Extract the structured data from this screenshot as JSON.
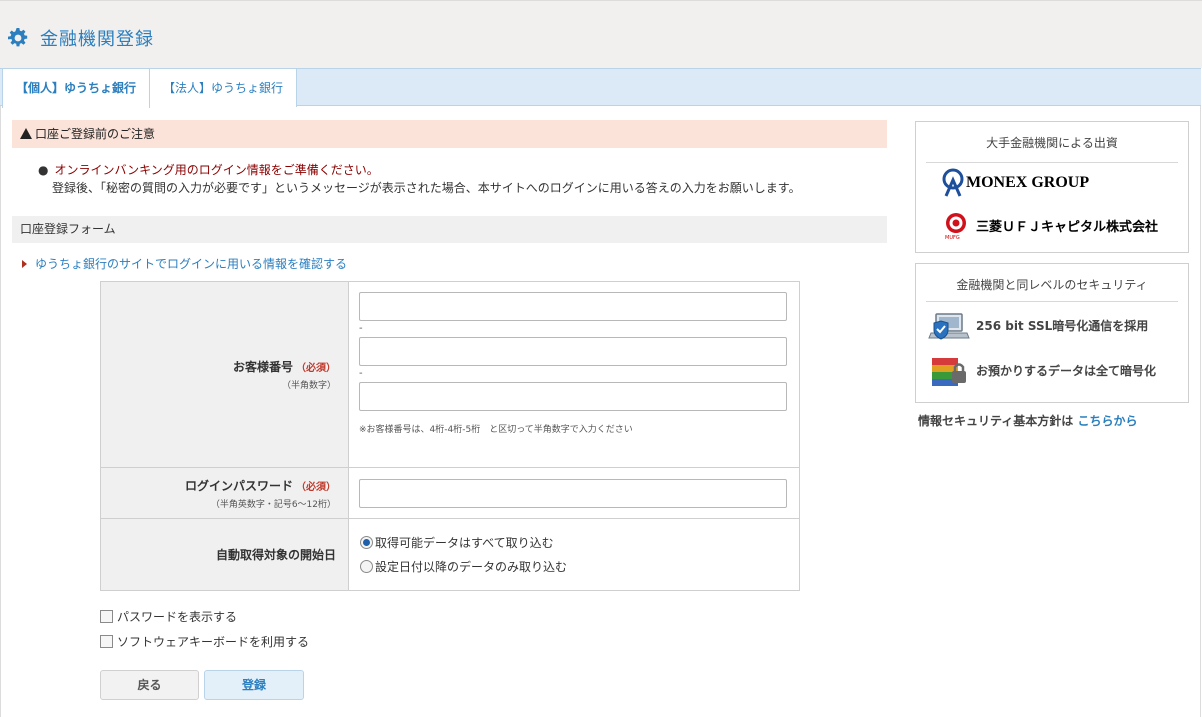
{
  "header": {
    "title": "金融機関登録",
    "icon": "gear-icon",
    "accent": "#2b7fbf"
  },
  "tabs": [
    {
      "label": "【個人】ゆうちょ銀行",
      "active": true
    },
    {
      "label": "【法人】ゆうちょ銀行",
      "active": false
    }
  ],
  "notice": {
    "title": "口座ご登録前のご注意",
    "line1": "オンラインバンキング用のログイン情報をご準備ください。",
    "line2": "登録後、「秘密の質問の入力が必要です」というメッセージが表示された場合、本サイトへのログインに用いる答えの入力をお願いします。"
  },
  "form": {
    "section_title": "口座登録フォーム",
    "confirm_link": "ゆうちょ銀行のサイトでログインに用いる情報を確認する",
    "customer_number": {
      "label": "お客様番号",
      "required": "（必須）",
      "sub": "（半角数字）",
      "separator": "-",
      "hint": "※お客様番号は、4桁-4桁-5桁　と区切って半角数字で入力ください",
      "values": [
        "",
        "",
        ""
      ]
    },
    "password": {
      "label": "ログインパスワード",
      "required": "（必須）",
      "sub": "（半角英数字・記号6～12桁）",
      "value": ""
    },
    "start_date": {
      "label": "自動取得対象の開始日",
      "options": [
        "取得可能データはすべて取り込む",
        "設定日付以降のデータのみ取り込む"
      ],
      "selected": 0
    },
    "show_password": "パスワードを表示する",
    "software_keyboard": "ソフトウェアキーボードを利用する",
    "back_button": "戻る",
    "submit_button": "登録"
  },
  "sidebar": {
    "investors_title": "大手金融機関による出資",
    "monex": "MONEX GROUP",
    "mufg": "三菱ＵＦＪキャピタル株式会社",
    "mufg_mark": "MUFG",
    "security_title": "金融機関と同レベルのセキュリティ",
    "ssl": "256 bit SSL暗号化通信を採用",
    "encrypt": "お預かりするデータは全て暗号化",
    "policy_text": "情報セキュリティ基本方針は",
    "policy_link": "こちらから"
  }
}
